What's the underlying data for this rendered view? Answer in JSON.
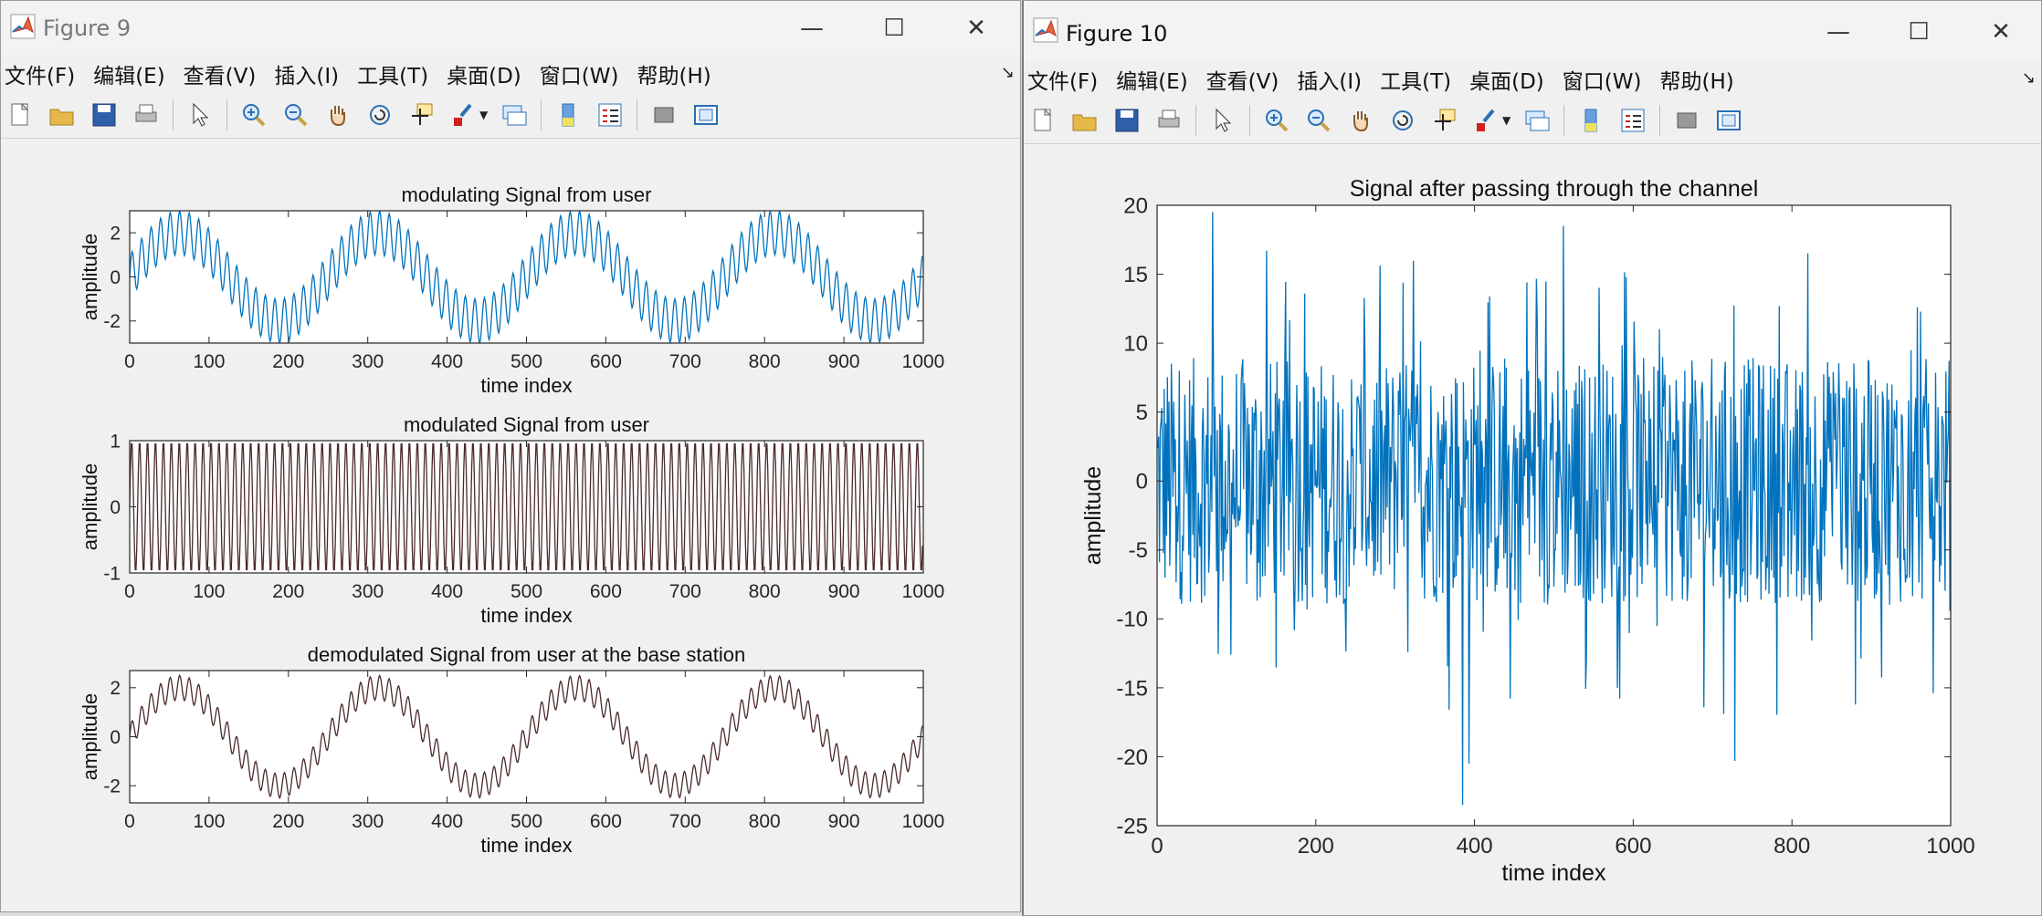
{
  "fig9": {
    "title": "Figure 9",
    "menu": [
      "文件(F)",
      "编辑(E)",
      "查看(V)",
      "插入(I)",
      "工具(T)",
      "桌面(D)",
      "窗口(W)",
      "帮助(H)"
    ],
    "controls": {
      "minimize": "—",
      "maximize": "☐",
      "close": "✕"
    }
  },
  "fig10": {
    "title": "Figure 10",
    "menu": [
      "文件(F)",
      "编辑(E)",
      "查看(V)",
      "插入(I)",
      "工具(T)",
      "桌面(D)",
      "窗口(W)",
      "帮助(H)"
    ],
    "controls": {
      "minimize": "—",
      "maximize": "☐",
      "close": "✕"
    }
  },
  "toolbar_icons": [
    "new-figure-icon",
    "open-file-icon",
    "save-icon",
    "print-icon",
    "pointer-icon",
    "zoom-in-icon",
    "zoom-out-icon",
    "pan-icon",
    "rotate-3d-icon",
    "data-cursor-icon",
    "brush-icon",
    "link-plot-icon",
    "colorbar-icon",
    "legend-icon",
    "hide-plot-tools-icon",
    "show-plot-tools-icon"
  ],
  "colors": {
    "blue": "#0072bd",
    "dark": "#4b2a2a"
  },
  "chart_data": [
    {
      "type": "line",
      "title": "modulating Signal from user",
      "xlabel": "time index",
      "ylabel": "amplitude",
      "xlim": [
        0,
        1000
      ],
      "ylim": [
        -3,
        3
      ],
      "xticks": [
        "0",
        "100",
        "200",
        "300",
        "400",
        "500",
        "600",
        "700",
        "800",
        "900",
        "1000"
      ],
      "yticks": [
        "2",
        "0",
        "-2"
      ],
      "series": [
        {
          "formula": "2*sin(2*pi*x/250) + sin(2*pi*x/12)",
          "samples": 1000,
          "color": "#0072bd"
        }
      ]
    },
    {
      "type": "line",
      "title": "modulated Signal from user",
      "xlabel": "time index",
      "ylabel": "amplitude",
      "xlim": [
        0,
        1000
      ],
      "ylim": [
        -1,
        1
      ],
      "xticks": [
        "0",
        "100",
        "200",
        "300",
        "400",
        "500",
        "600",
        "700",
        "800",
        "900",
        "1000"
      ],
      "yticks": [
        "1",
        "0",
        "-1"
      ],
      "series": [
        {
          "formula": "sin(2*pi*x/10)",
          "samples": 1000,
          "color": "#4b2a2a"
        }
      ]
    },
    {
      "type": "line",
      "title": "demodulated Signal from user at the base station",
      "xlabel": "time index",
      "ylabel": "amplitude",
      "xlim": [
        0,
        1000
      ],
      "ylim": [
        -2.7,
        2.7
      ],
      "xticks": [
        "0",
        "100",
        "200",
        "300",
        "400",
        "500",
        "600",
        "700",
        "800",
        "900",
        "1000"
      ],
      "yticks": [
        "2",
        "0",
        "-2"
      ],
      "series": [
        {
          "formula": "2*sin(2*pi*x/250) + 0.5*sin(2*pi*x/12)",
          "samples": 1000,
          "color": "#4b2a2a"
        }
      ]
    },
    {
      "type": "line",
      "title": "Signal after passing through the channel",
      "xlabel": "time index",
      "ylabel": "amplitude",
      "xlim": [
        0,
        1000
      ],
      "ylim": [
        -25,
        20
      ],
      "xticks": [
        "0",
        "200",
        "400",
        "600",
        "800",
        "1000"
      ],
      "yticks": [
        "20",
        "15",
        "10",
        "5",
        "0",
        "-5",
        "-10",
        "-15",
        "-20",
        "-25"
      ],
      "series": [
        {
          "formula": "noisy channel output, approx. uniform in [-15, 15] with spikes",
          "samples": 1000,
          "color": "#0072bd",
          "min": -23.5,
          "max": 19.5
        }
      ]
    }
  ]
}
